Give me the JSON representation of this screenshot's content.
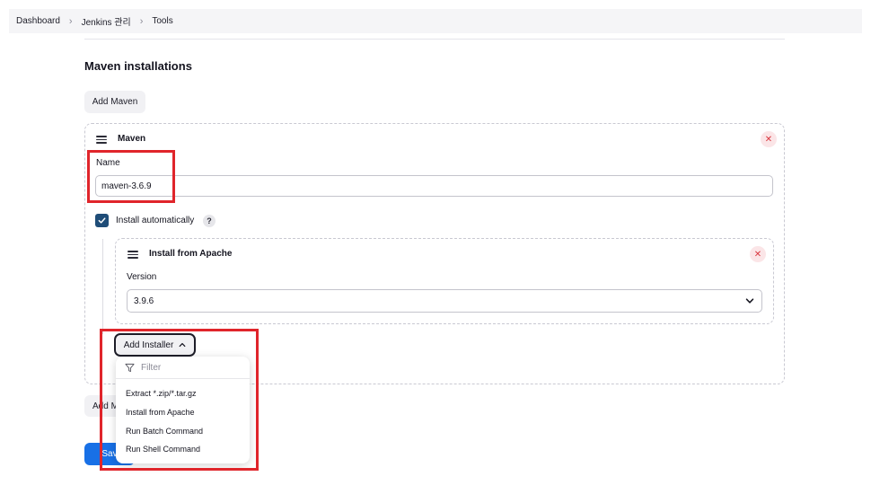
{
  "breadcrumb": [
    "Dashboard",
    "Jenkins 관리",
    "Tools"
  ],
  "section": {
    "title": "Maven installations",
    "add_button": "Add Maven"
  },
  "maven_card": {
    "title": "Maven",
    "name_label": "Name",
    "name_value": "maven-3.6.9",
    "install_auto_label": "Install automatically",
    "install_auto_checked": true,
    "help_glyph": "?",
    "close_glyph": "✕"
  },
  "installer_card": {
    "title": "Install from Apache",
    "version_label": "Version",
    "version_value": "3.9.6",
    "close_glyph": "✕"
  },
  "add_installer_label": "Add Installer",
  "dropdown": {
    "filter_placeholder": "Filter",
    "items": [
      "Extract *.zip/*.tar.gz",
      "Install from Apache",
      "Run Batch Command",
      "Run Shell Command"
    ]
  },
  "partially_hidden_button": "Add M",
  "save_label": "Sav",
  "colors": {
    "accent": "#1870e6",
    "highlight": "#e0252b",
    "checkbox": "#1f4d78",
    "close": "#d9363e"
  },
  "icons": [
    "drag-handle-icon",
    "close-icon",
    "checkmark-icon",
    "help-icon",
    "chevron-down-icon",
    "chevron-up-icon",
    "filter-icon"
  ]
}
